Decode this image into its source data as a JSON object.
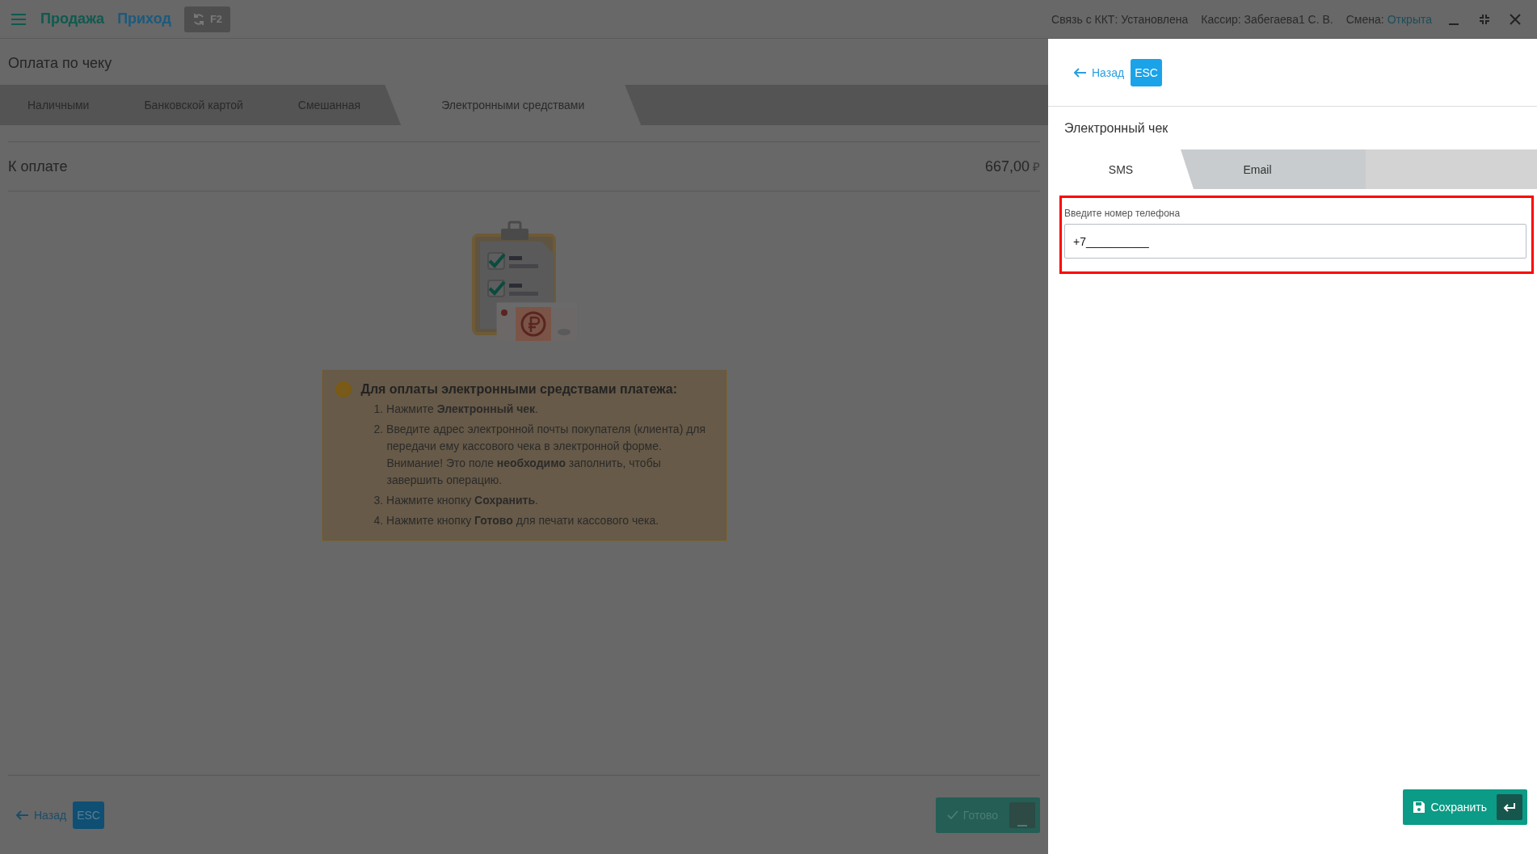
{
  "top_bar": {
    "modes": [
      {
        "label": "Продажа",
        "color": "#0e5a4f"
      },
      {
        "label": "Приход",
        "color": "#1b5a7c"
      }
    ],
    "refresh_key": "F2",
    "connection": "Связь с ККТ: Установлена",
    "cashier": "Кассир: Забегаева1 С. В.",
    "shift": {
      "label": "Смена:",
      "value": "Открыта"
    }
  },
  "page": {
    "title": "Оплата по чеку",
    "tabs": [
      {
        "label": "Наличными",
        "selected": false
      },
      {
        "label": "Банковской картой",
        "selected": false
      },
      {
        "label": "Смешанная",
        "selected": false
      },
      {
        "label": "Электронными средствами",
        "selected": true
      }
    ],
    "amount": {
      "label": "К оплате",
      "value": "667,00",
      "currency": "₽"
    },
    "info": {
      "title": "Для оплаты электронными средствами платежа:",
      "steps": [
        "1. Нажмите **Электронный чек**.",
        "2. Введите адрес электронной почты покупателя (клиента) для передачи ему кассового чека в электронной форме. Внимание! Это поле **необходимо** заполнить, чтобы завершить операцию.",
        "3. Нажмите кнопку **Сохранить**.",
        "4. Нажмите кнопку **Готово** для печати кассового чека."
      ]
    },
    "back": {
      "label": "Назад",
      "key": "ESC"
    },
    "done": {
      "label": "Готово",
      "disabled": true
    }
  },
  "panel": {
    "back": {
      "label": "Назад",
      "key": "ESC"
    },
    "title": "Электронный чек",
    "tabs": [
      {
        "label": "SMS",
        "selected": true
      },
      {
        "label": "Email",
        "selected": false
      }
    ],
    "phone": {
      "label": "Введите номер телефона",
      "value": "+7__________"
    },
    "save": {
      "label": "Сохранить"
    }
  }
}
